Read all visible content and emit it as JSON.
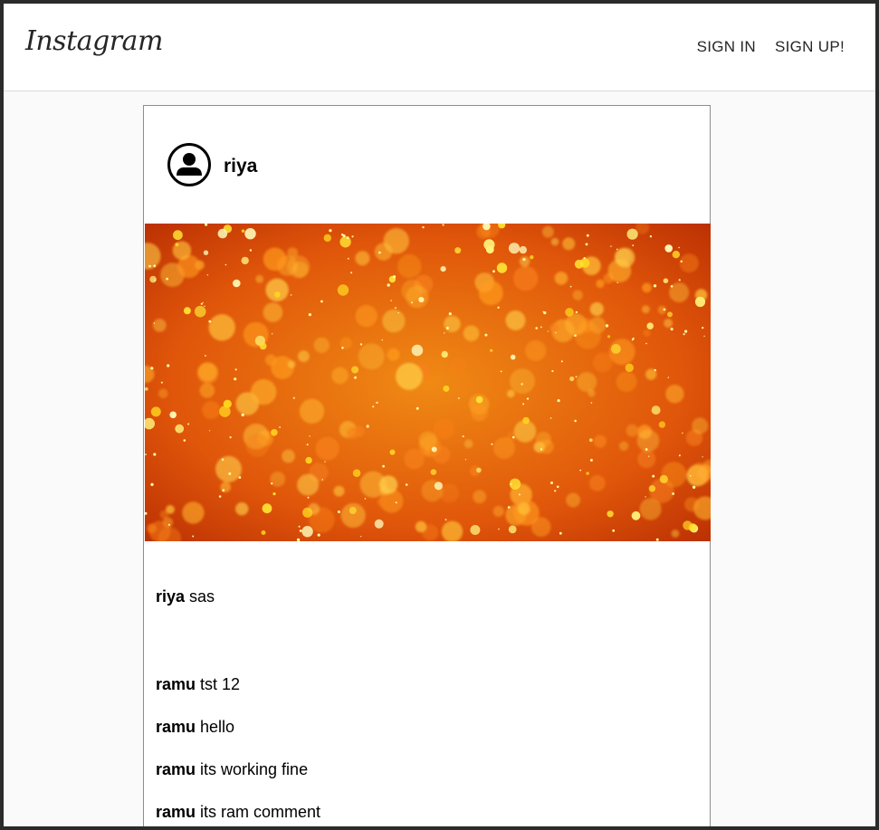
{
  "header": {
    "logo": "Instagram",
    "nav": [
      {
        "label": "SIGN IN"
      },
      {
        "label": "SIGN UP!"
      }
    ]
  },
  "post": {
    "username": "riya",
    "avatar_icon": "user-avatar-icon",
    "image": "orange-gold bokeh glitter",
    "caption": {
      "username": "riya",
      "text": "sas"
    },
    "comments": [
      {
        "username": "ramu",
        "text": "tst 12"
      },
      {
        "username": "ramu",
        "text": "hello"
      },
      {
        "username": "ramu",
        "text": "its working fine"
      },
      {
        "username": "ramu",
        "text": "its ram comment"
      }
    ]
  },
  "colors": {
    "page_bg": "#fafafa",
    "header_bg": "#ffffff",
    "border": "#dbdbdb",
    "text": "#262626",
    "image_primary": "#e8620c",
    "image_highlight": "#ffe033"
  }
}
